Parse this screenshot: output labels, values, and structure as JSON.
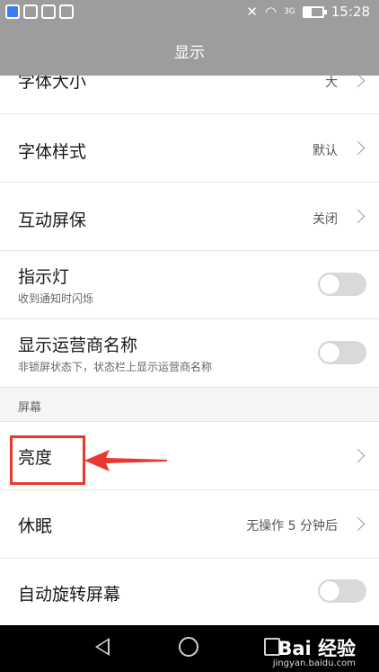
{
  "statusbar": {
    "time": "15:28",
    "network": "3G"
  },
  "header": {
    "title": "显示"
  },
  "rows": {
    "font_size": {
      "title": "字体大小",
      "value": "大"
    },
    "font_style": {
      "title": "字体样式",
      "value": "默认"
    },
    "screensaver": {
      "title": "互动屏保",
      "value": "关闭"
    },
    "indicator": {
      "title": "指示灯",
      "subtitle": "收到通知时闪烁",
      "enabled": false
    },
    "carrier_name": {
      "title": "显示运营商名称",
      "subtitle": "非锁屏状态下，状态栏上显示运营商名称",
      "enabled": false
    },
    "brightness": {
      "title": "亮度"
    },
    "sleep": {
      "title": "休眠",
      "value": "无操作 5 分钟后"
    },
    "auto_rotate": {
      "title": "自动旋转屏幕",
      "enabled": false
    }
  },
  "section": {
    "screen": "屏幕"
  },
  "watermark": {
    "logo": "Bai 经验",
    "url": "jingyan.baidu.com"
  },
  "colors": {
    "header_bg": "#9d9d9d",
    "annotation": "#e8392f",
    "toggle_off": "#d9d9d9"
  }
}
